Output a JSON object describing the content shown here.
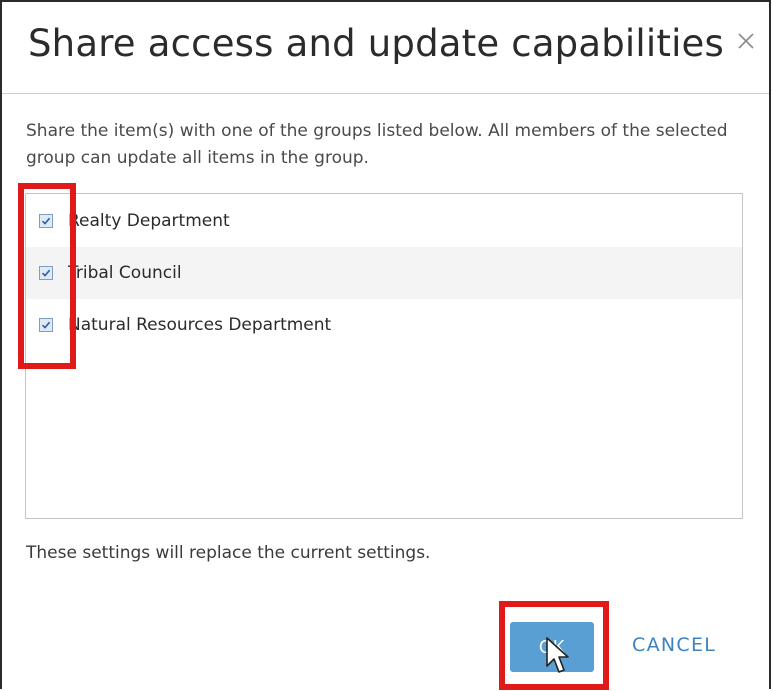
{
  "dialog": {
    "title": "Share access and update capabilities",
    "close_icon": "close-icon",
    "description": "Share the item(s) with one of the groups listed below. All members of the selected group can update all items in the group.",
    "groups": [
      {
        "label": "Realty Department",
        "checked": true
      },
      {
        "label": "Tribal Council",
        "checked": true
      },
      {
        "label": "Natural Resources Department",
        "checked": true
      }
    ],
    "footer_note": "These settings will replace the current settings.",
    "ok_label": "OK",
    "cancel_label": "CANCEL"
  },
  "colors": {
    "highlight": "#e01919",
    "primary_button": "#5a9fd3",
    "link": "#3d83bf",
    "checkbox_fill": "#dfeaf7"
  }
}
